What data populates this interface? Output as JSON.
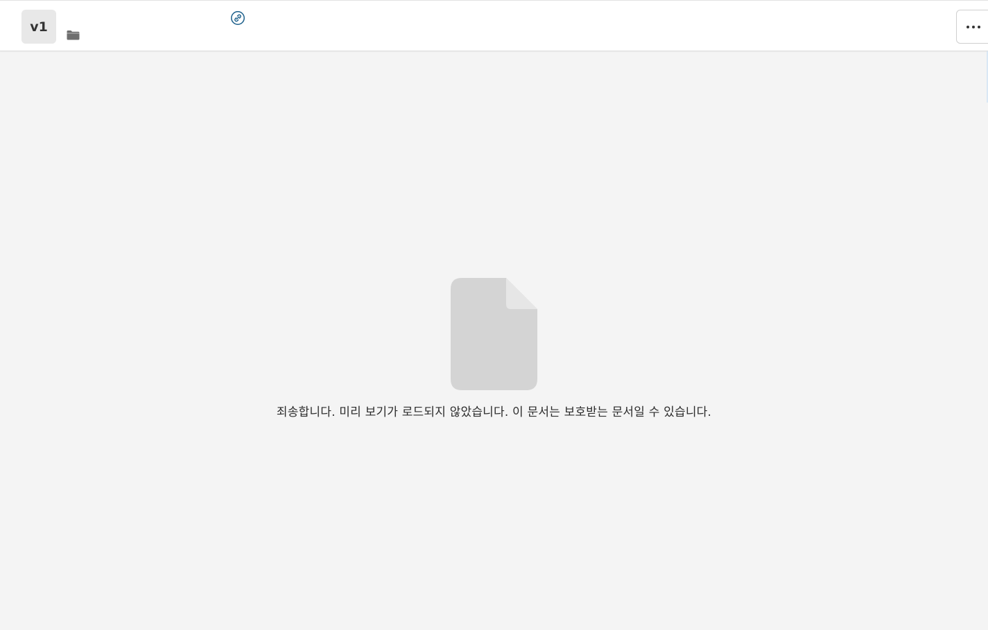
{
  "header": {
    "version_label": "v1",
    "file_title": "",
    "folder_path": "",
    "link_icon": "link-icon",
    "folder_icon": "folder-icon",
    "more_icon": "more-horizontal-icon"
  },
  "preview": {
    "doc_icon": "document-icon",
    "message": "죄송합니다. 미리 보기가 로드되지 않았습니다. 이 문서는 보호받는 문서일 수 있습니다."
  },
  "colors": {
    "background": "#f4f4f4",
    "header_bg": "#ffffff",
    "badge_bg": "#e8e8e8",
    "link_icon": "#1a5e8a",
    "doc_icon": "#d4d4d4",
    "doc_fold": "#e6e6e6"
  }
}
